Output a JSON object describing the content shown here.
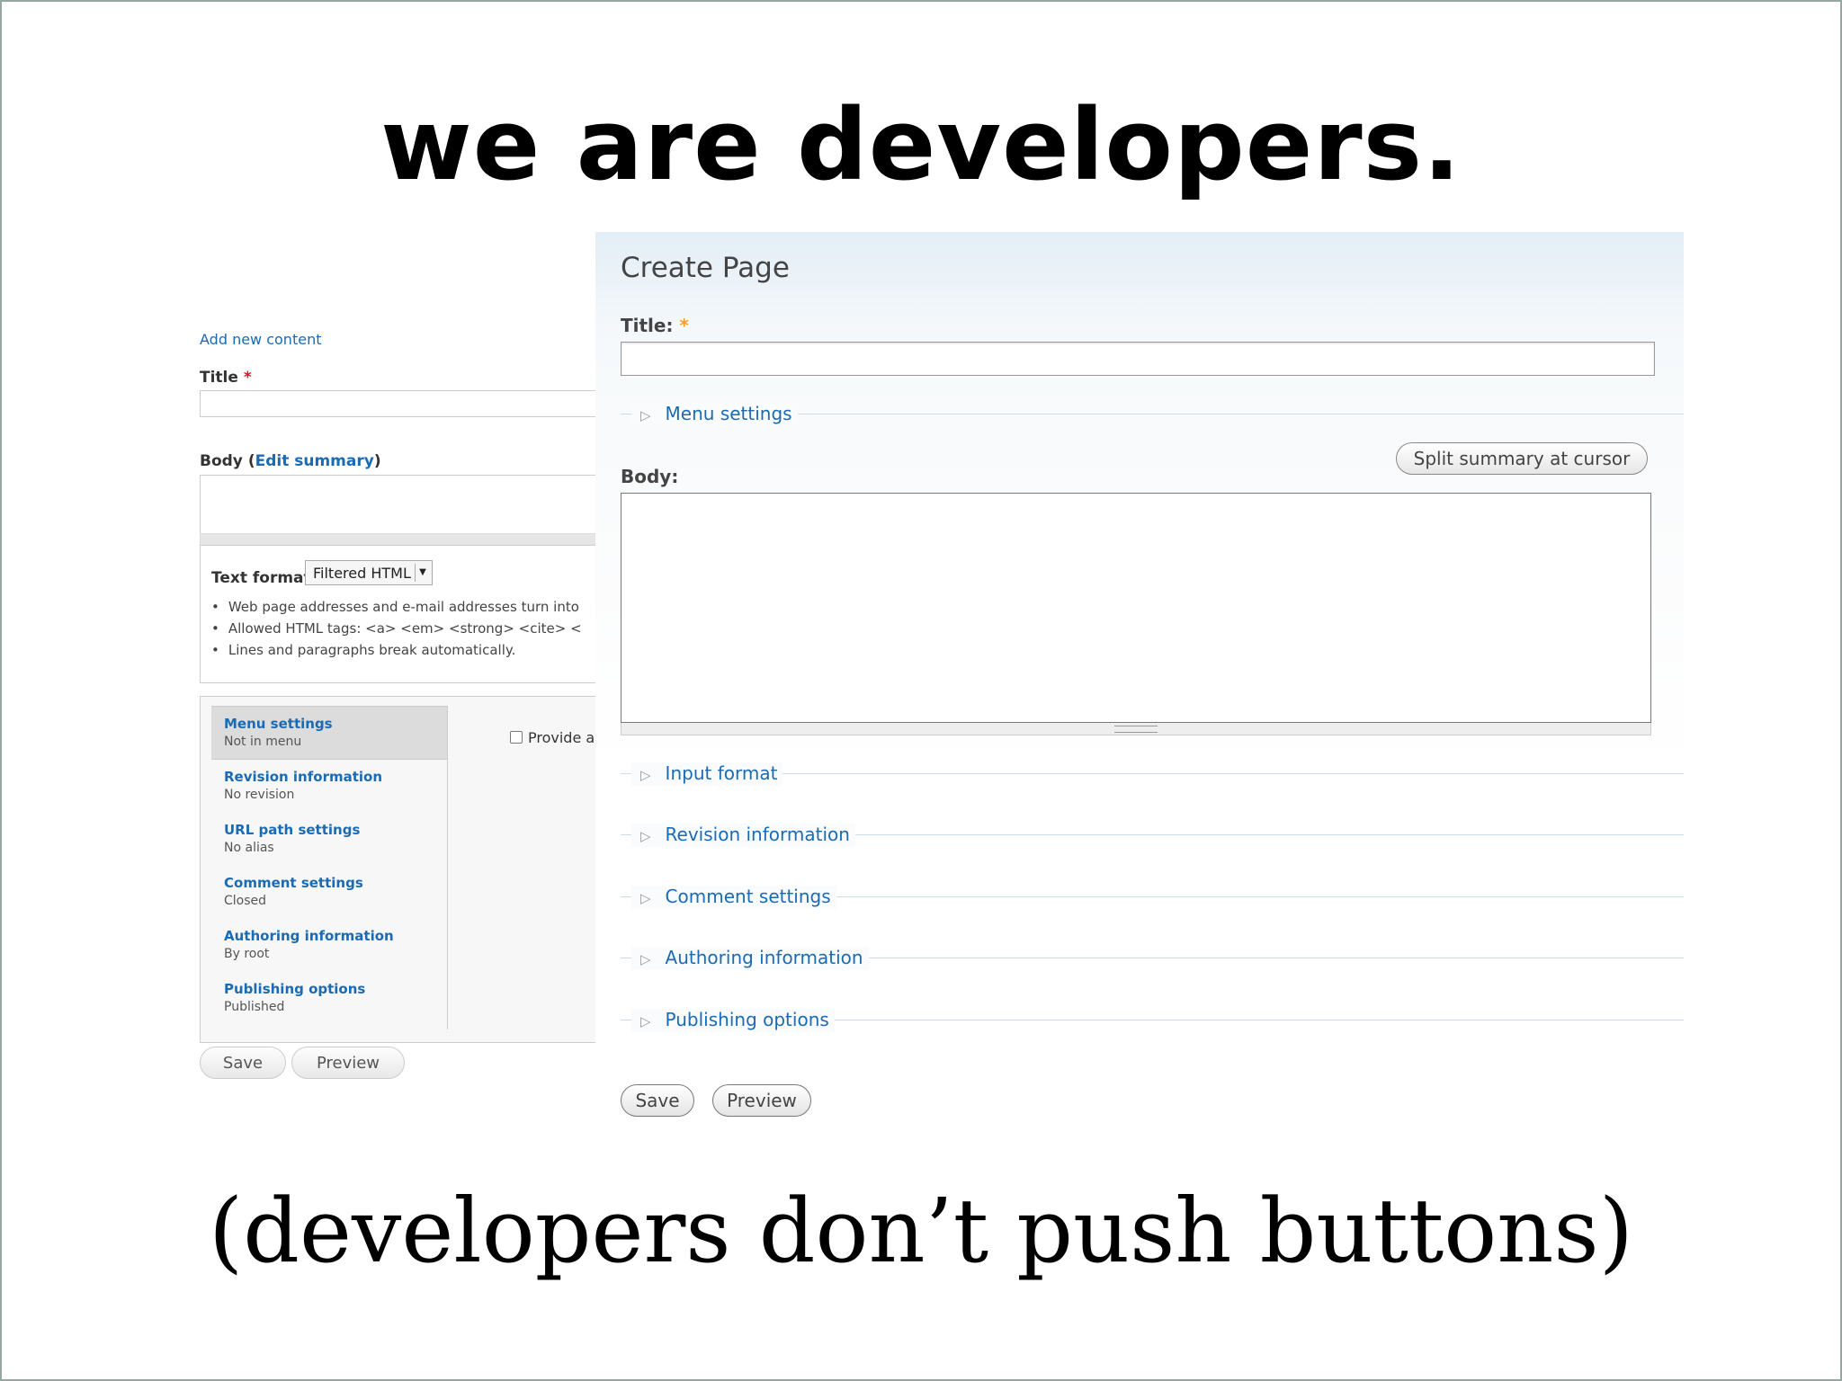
{
  "slide": {
    "title": "we are developers.",
    "caption": "(developers don’t push buttons)"
  },
  "left_screenshot": {
    "breadcrumb": "Add new content",
    "title_label": "Title",
    "required_mark": "*",
    "body_label": "Body",
    "body_paren_open": "(",
    "edit_summary_link": "Edit summary",
    "body_paren_close": ")",
    "text_format_label": "Text format",
    "text_format_value": "Filtered HTML",
    "format_tips": [
      "Web page addresses and e-mail addresses turn into",
      "Allowed HTML tags: <a> <em> <strong> <cite> <",
      "Lines and paragraphs break automatically."
    ],
    "vertical_tabs": [
      {
        "title": "Menu settings",
        "summary": "Not in menu",
        "selected": true
      },
      {
        "title": "Revision information",
        "summary": "No revision",
        "selected": false
      },
      {
        "title": "URL path settings",
        "summary": "No alias",
        "selected": false
      },
      {
        "title": "Comment settings",
        "summary": "Closed",
        "selected": false
      },
      {
        "title": "Authoring information",
        "summary": "By root",
        "selected": false
      },
      {
        "title": "Publishing options",
        "summary": "Published",
        "selected": false
      }
    ],
    "pane_checkbox_label": "Provide a",
    "save_label": "Save",
    "preview_label": "Preview"
  },
  "right_screenshot": {
    "page_title": "Create Page",
    "title_label": "Title:",
    "required_mark": "*",
    "menu_settings": "Menu settings",
    "split_summary_label": "Split summary at cursor",
    "body_label": "Body:",
    "fieldsets": [
      "Input format",
      "Revision information",
      "Comment settings",
      "Authoring information",
      "Publishing options"
    ],
    "save_label": "Save",
    "preview_label": "Preview"
  },
  "colors": {
    "link": "#1a6bb3",
    "required_left": "#dd1122",
    "required_right": "#f0a02a",
    "slide_border": "#97a6a0"
  }
}
